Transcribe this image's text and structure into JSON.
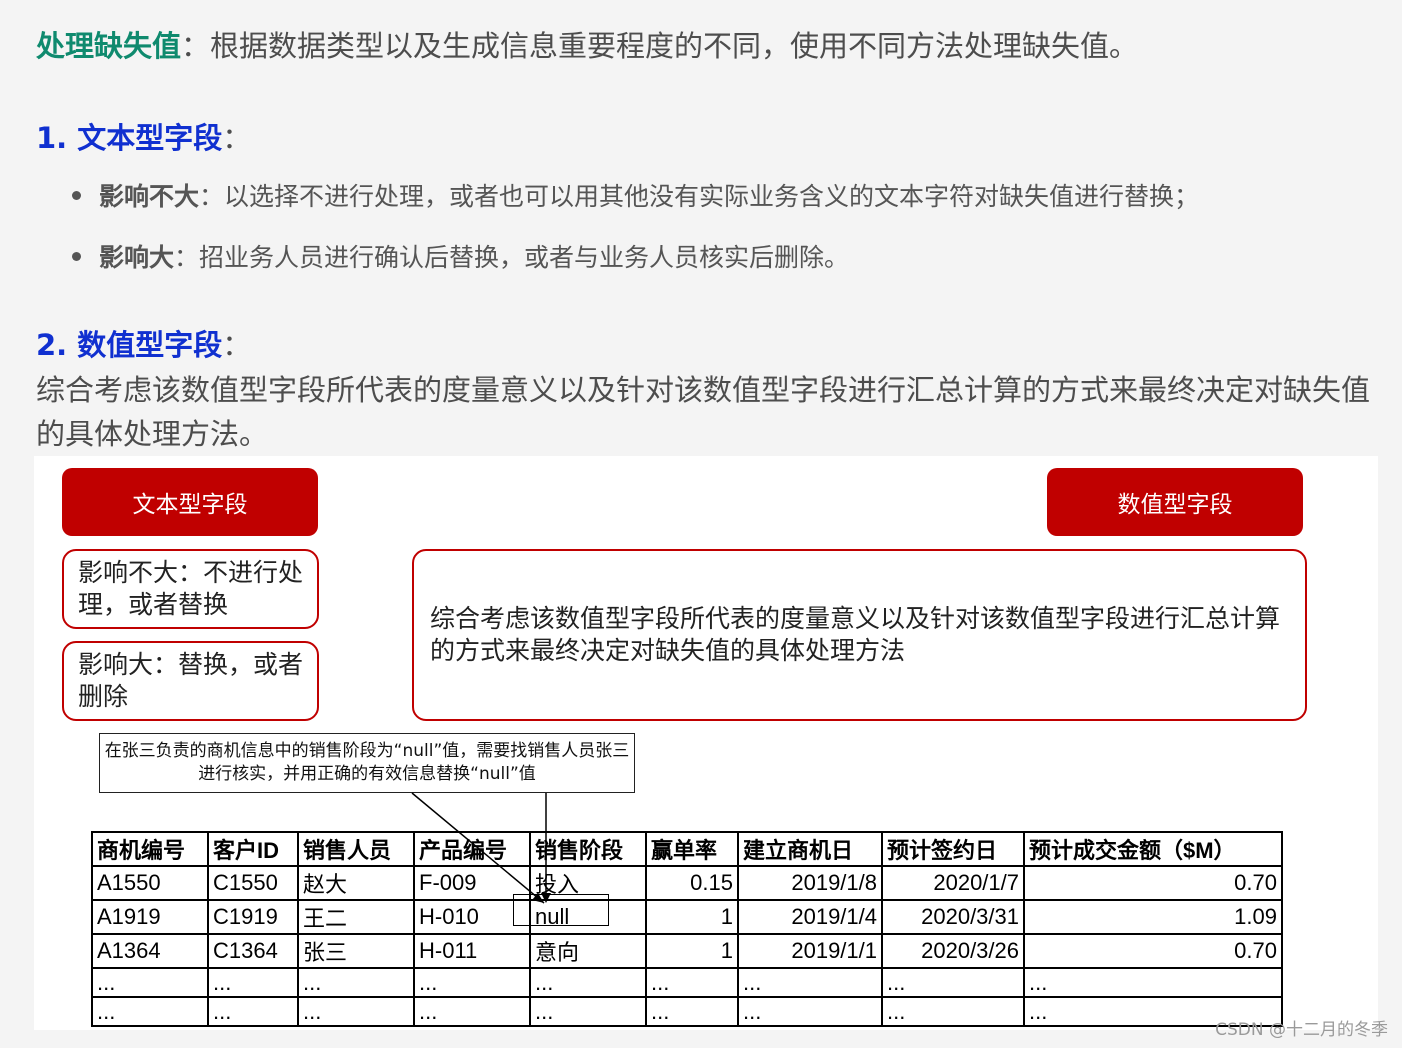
{
  "intro": {
    "keyword": "处理缺失值",
    "text": "：根据数据类型以及生成信息重要程度的不同，使用不同方法处理缺失值。"
  },
  "section1": {
    "heading": "1. 文本型字段",
    "colon": "：",
    "bullets": [
      {
        "label": "影响不大",
        "text": "：以选择不进行处理，或者也可以用其他没有实际业务含义的文本字符对缺失值进行替换；"
      },
      {
        "label": "影响大",
        "text": "：招业务人员进行确认后替换，或者与业务人员核实后删除。"
      }
    ]
  },
  "section2": {
    "heading": "2. 数值型字段",
    "colon": "：",
    "text": "综合考虑该数值型字段所代表的度量意义以及针对该数值型字段进行汇总计算的方式来最终决定对缺失值的具体处理方法。"
  },
  "figure": {
    "text_field_title": "文本型字段",
    "numeric_field_title": "数值型字段",
    "text_box_1": "影响不大：不进行处理，或者替换",
    "text_box_2": "影响大：替换，或者删除",
    "numeric_box": "综合考虑该数值型字段所代表的度量意义以及针对该数值型字段进行汇总计算的方式来最终决定对缺失值的具体处理方法",
    "callout": "在张三负责的商机信息中的销售阶段为“null”值，需要找销售人员张三进行核实，并用正确的有效信息替换“null”值",
    "table": {
      "headers": [
        "商机编号",
        "客户ID",
        "销售人员",
        "产品编号",
        "销售阶段",
        "赢单率",
        "建立商机日",
        "预计签约日",
        "预计成交金额（$M）"
      ],
      "rows": [
        [
          "A1550",
          "C1550",
          "赵大",
          "F-009",
          "投入",
          "0.15",
          "2019/1/8",
          "2020/1/7",
          "0.70"
        ],
        [
          "A1919",
          "C1919",
          "王二",
          "H-010",
          "null",
          "1",
          "2019/1/4",
          "2020/3/31",
          "1.09"
        ],
        [
          "A1364",
          "C1364",
          "张三",
          "H-011",
          "意向",
          "1",
          "2019/1/1",
          "2020/3/26",
          "0.70"
        ],
        [
          "...",
          "...",
          "...",
          "...",
          "...",
          "...",
          "...",
          "...",
          "..."
        ],
        [
          "...",
          "...",
          "...",
          "...",
          "...",
          "...",
          "...",
          "...",
          "..."
        ]
      ]
    }
  },
  "watermark": "CSDN @十二月的冬季"
}
